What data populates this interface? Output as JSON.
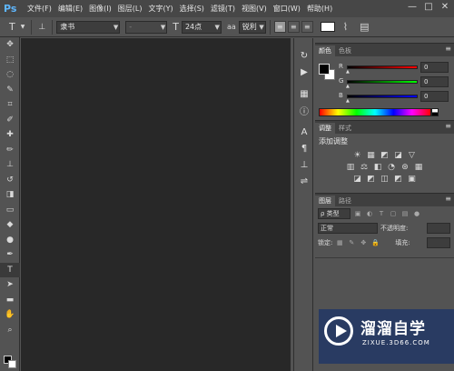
{
  "app": {
    "logo": "Ps"
  },
  "menu": [
    "文件(F)",
    "编辑(E)",
    "图像(I)",
    "图层(L)",
    "文字(Y)",
    "选择(S)",
    "滤镜(T)",
    "视图(V)",
    "窗口(W)",
    "帮助(H)"
  ],
  "window_controls": {
    "minimize": "—",
    "maximize": "□",
    "close": "✕"
  },
  "options_bar": {
    "tool_icon": "T",
    "font_family": "隶书",
    "font_style": "-",
    "font_size": "24点",
    "anti_alias_label": "aa",
    "anti_alias": "锐利",
    "text_color": "#ffffff"
  },
  "tools": [
    {
      "name": "move-tool",
      "glyph": "✥"
    },
    {
      "name": "marquee-tool",
      "glyph": "⬚"
    },
    {
      "name": "lasso-tool",
      "glyph": "◌"
    },
    {
      "name": "quick-select-tool",
      "glyph": "✎"
    },
    {
      "name": "crop-tool",
      "glyph": "⌗"
    },
    {
      "name": "eyedropper-tool",
      "glyph": "✐"
    },
    {
      "name": "healing-brush-tool",
      "glyph": "✚"
    },
    {
      "name": "brush-tool",
      "glyph": "✏"
    },
    {
      "name": "clone-stamp-tool",
      "glyph": "⊥"
    },
    {
      "name": "history-brush-tool",
      "glyph": "↺"
    },
    {
      "name": "eraser-tool",
      "glyph": "◨"
    },
    {
      "name": "gradient-tool",
      "glyph": "▭"
    },
    {
      "name": "blur-tool",
      "glyph": "💧"
    },
    {
      "name": "dodge-tool",
      "glyph": "●"
    },
    {
      "name": "pen-tool",
      "glyph": "✒"
    },
    {
      "name": "type-tool",
      "glyph": "T"
    },
    {
      "name": "path-select-tool",
      "glyph": "➤"
    },
    {
      "name": "shape-tool",
      "glyph": "▬"
    },
    {
      "name": "hand-tool",
      "glyph": "✋"
    },
    {
      "name": "zoom-tool",
      "glyph": "🔍"
    }
  ],
  "color_panel": {
    "tabs": [
      "颜色",
      "色板"
    ],
    "fg_color": "#000000",
    "bg_color": "#ffffff",
    "channels": [
      {
        "label": "R",
        "value": "0",
        "gradient": "linear-gradient(to right,#000,#f00)"
      },
      {
        "label": "G",
        "value": "0",
        "gradient": "linear-gradient(to right,#000,#0f0)"
      },
      {
        "label": "B",
        "value": "0",
        "gradient": "linear-gradient(to right,#000,#00f)"
      }
    ]
  },
  "adjustments_panel": {
    "tabs": [
      "调整",
      "样式"
    ],
    "title": "添加调整",
    "row1": [
      "☀",
      "▦",
      "◩",
      "◪",
      "▽"
    ],
    "row2": [
      "▥",
      "⚖",
      "◧",
      "◔",
      "⊛",
      "▦"
    ],
    "row3": [
      "◪",
      "◩",
      "◫",
      "◩",
      "▣"
    ]
  },
  "layers_panel": {
    "tabs": [
      "图层",
      "路径"
    ],
    "filter_kind": "ρ 类型",
    "blend_mode": "正常",
    "opacity_label": "不透明度:",
    "lock_label": "锁定:",
    "fill_label": "填充:"
  },
  "watermark": {
    "title": "溜溜自学",
    "url": "ZIXUE.3D66.COM"
  }
}
